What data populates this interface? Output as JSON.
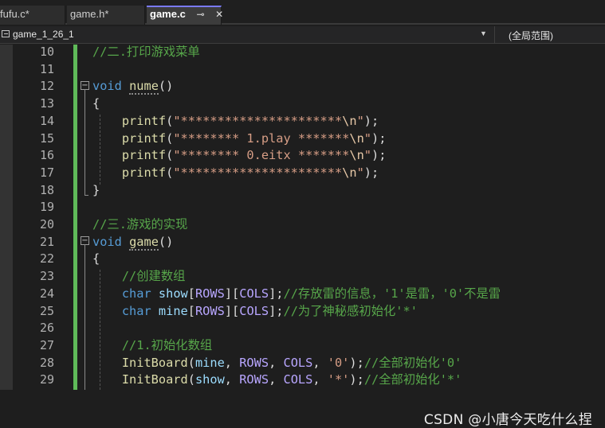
{
  "tabs": [
    {
      "label": "fufu.c*"
    },
    {
      "label": "game.h*"
    },
    {
      "label": "game.c"
    }
  ],
  "navbar": {
    "project": "game_1_26_1",
    "scope": "(全局范围)"
  },
  "editor": {
    "lines": [
      {
        "n": "10",
        "tokens": [
          [
            "cm",
            "//二.打印游戏菜单"
          ]
        ]
      },
      {
        "n": "11",
        "tokens": []
      },
      {
        "n": "12",
        "tokens": [
          [
            "kw",
            "void"
          ],
          [
            "pun",
            " "
          ],
          [
            "fn",
            "nume",
            "squig"
          ],
          [
            "pun",
            "()"
          ]
        ]
      },
      {
        "n": "13",
        "tokens": [
          [
            "pun",
            "{"
          ]
        ]
      },
      {
        "n": "14",
        "tokens": [
          [
            "pun",
            "    "
          ],
          [
            "fn",
            "printf"
          ],
          [
            "pun",
            "("
          ],
          [
            "str",
            "\"**********************"
          ],
          [
            "esc",
            "\\n"
          ],
          [
            "str",
            "\""
          ],
          [
            "pun",
            ");"
          ]
        ]
      },
      {
        "n": "15",
        "tokens": [
          [
            "pun",
            "    "
          ],
          [
            "fn",
            "printf"
          ],
          [
            "pun",
            "("
          ],
          [
            "str",
            "\"******** 1.play *******"
          ],
          [
            "esc",
            "\\n"
          ],
          [
            "str",
            "\""
          ],
          [
            "pun",
            ");"
          ]
        ]
      },
      {
        "n": "16",
        "tokens": [
          [
            "pun",
            "    "
          ],
          [
            "fn",
            "printf"
          ],
          [
            "pun",
            "("
          ],
          [
            "str",
            "\"******** 0.eitx *******"
          ],
          [
            "esc",
            "\\n"
          ],
          [
            "str",
            "\""
          ],
          [
            "pun",
            ");"
          ]
        ]
      },
      {
        "n": "17",
        "tokens": [
          [
            "pun",
            "    "
          ],
          [
            "fn",
            "printf"
          ],
          [
            "pun",
            "("
          ],
          [
            "str",
            "\"**********************"
          ],
          [
            "esc",
            "\\n"
          ],
          [
            "str",
            "\""
          ],
          [
            "pun",
            ");"
          ]
        ]
      },
      {
        "n": "18",
        "tokens": [
          [
            "pun",
            "}"
          ]
        ]
      },
      {
        "n": "19",
        "tokens": []
      },
      {
        "n": "20",
        "tokens": [
          [
            "cm",
            "//三.游戏的实现"
          ]
        ]
      },
      {
        "n": "21",
        "tokens": [
          [
            "kw",
            "void"
          ],
          [
            "pun",
            " "
          ],
          [
            "fn",
            "game",
            "squig"
          ],
          [
            "pun",
            "()"
          ]
        ]
      },
      {
        "n": "22",
        "tokens": [
          [
            "pun",
            "{"
          ]
        ]
      },
      {
        "n": "23",
        "tokens": [
          [
            "pun",
            "    "
          ],
          [
            "cm",
            "//创建数组"
          ]
        ]
      },
      {
        "n": "24",
        "tokens": [
          [
            "pun",
            "    "
          ],
          [
            "kw",
            "char"
          ],
          [
            "pun",
            " "
          ],
          [
            "id",
            "show"
          ],
          [
            "pun",
            "["
          ],
          [
            "mac",
            "ROWS"
          ],
          [
            "pun",
            "]["
          ],
          [
            "mac",
            "COLS"
          ],
          [
            "pun",
            "];"
          ],
          [
            "cm",
            "//存放雷的信息，'1'是雷，'0'不是雷"
          ]
        ]
      },
      {
        "n": "25",
        "tokens": [
          [
            "pun",
            "    "
          ],
          [
            "kw",
            "char"
          ],
          [
            "pun",
            " "
          ],
          [
            "id",
            "mine"
          ],
          [
            "pun",
            "["
          ],
          [
            "mac",
            "ROWS"
          ],
          [
            "pun",
            "]["
          ],
          [
            "mac",
            "COLS"
          ],
          [
            "pun",
            "];"
          ],
          [
            "cm",
            "//为了神秘感初始化'*'"
          ]
        ]
      },
      {
        "n": "26",
        "tokens": []
      },
      {
        "n": "27",
        "tokens": [
          [
            "pun",
            "    "
          ],
          [
            "cm",
            "//1.初始化数组"
          ]
        ]
      },
      {
        "n": "28",
        "tokens": [
          [
            "pun",
            "    "
          ],
          [
            "fn",
            "InitBoard"
          ],
          [
            "pun",
            "("
          ],
          [
            "id",
            "mine"
          ],
          [
            "pun",
            ", "
          ],
          [
            "mac",
            "ROWS"
          ],
          [
            "pun",
            ", "
          ],
          [
            "mac",
            "COLS"
          ],
          [
            "pun",
            ", "
          ],
          [
            "str",
            "'0'"
          ],
          [
            "pun",
            ");"
          ],
          [
            "cm",
            "//全部初始化'0'"
          ]
        ]
      },
      {
        "n": "29",
        "tokens": [
          [
            "pun",
            "    "
          ],
          [
            "fn",
            "InitBoard"
          ],
          [
            "pun",
            "("
          ],
          [
            "id",
            "show"
          ],
          [
            "pun",
            ", "
          ],
          [
            "mac",
            "ROWS"
          ],
          [
            "pun",
            ", "
          ],
          [
            "mac",
            "COLS"
          ],
          [
            "pun",
            ", "
          ],
          [
            "str",
            "'*'"
          ],
          [
            "pun",
            ");"
          ],
          [
            "cm",
            "//全部初始化'*'"
          ]
        ]
      }
    ]
  },
  "watermark": "CSDN @小唐今天吃什么捏",
  "colors": {
    "background": "#1e1e1e",
    "keyword": "#569cd6",
    "function": "#dcdcaa",
    "comment": "#57a64a",
    "string": "#d69d85",
    "macro": "#b8a6ff",
    "identifier": "#9cdcfe",
    "changebar": "#5fba59"
  }
}
